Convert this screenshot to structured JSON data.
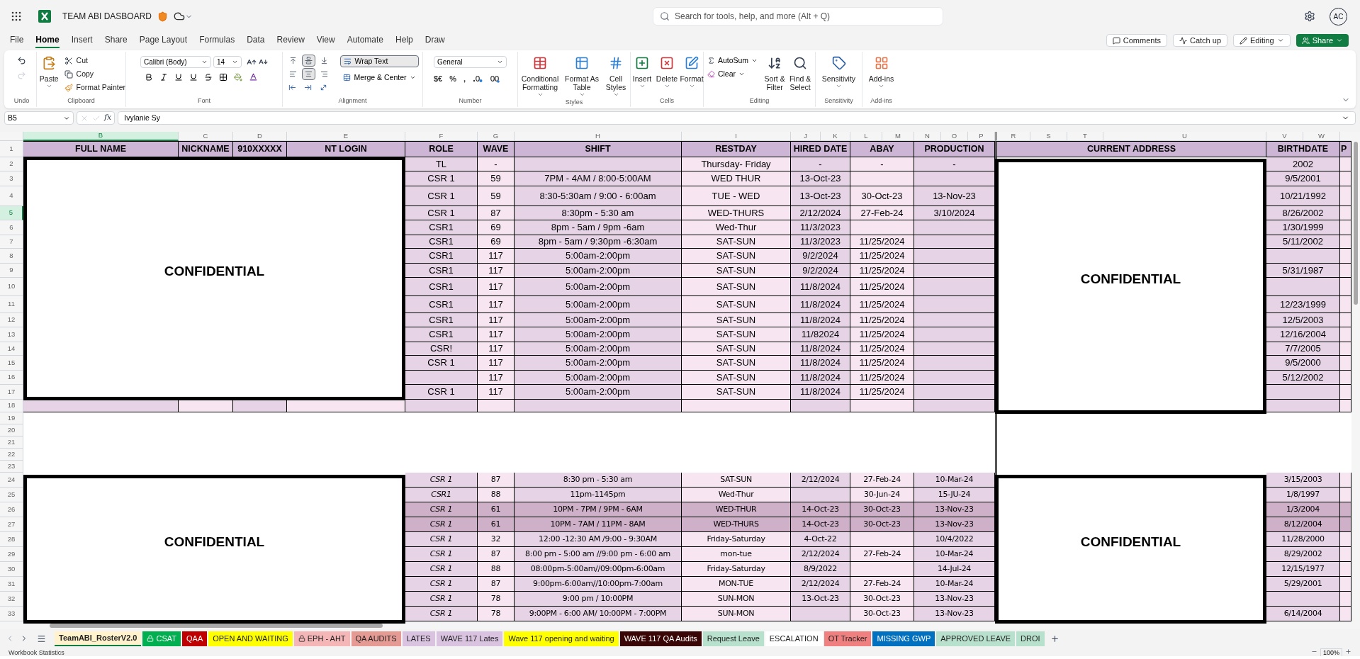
{
  "app": {
    "title": "TEAM ABI DASBOARD",
    "search": {
      "placeholder": "Search for tools, help, and more (Alt + Q)"
    },
    "avatar": "AC"
  },
  "menu": {
    "tabs": [
      {
        "label": "File",
        "selected": false
      },
      {
        "label": "Home",
        "selected": true
      },
      {
        "label": "Insert",
        "selected": false
      },
      {
        "label": "Share",
        "selected": false
      },
      {
        "label": "Page Layout",
        "selected": false
      },
      {
        "label": "Formulas",
        "selected": false
      },
      {
        "label": "Data",
        "selected": false
      },
      {
        "label": "Review",
        "selected": false
      },
      {
        "label": "View",
        "selected": false
      },
      {
        "label": "Automate",
        "selected": false
      },
      {
        "label": "Help",
        "selected": false
      },
      {
        "label": "Draw",
        "selected": false
      }
    ],
    "actions": [
      {
        "kind": "comments",
        "label": "Comments"
      },
      {
        "kind": "catchup",
        "label": "Catch up"
      },
      {
        "kind": "editing",
        "label": "Editing"
      },
      {
        "kind": "share",
        "label": "Share"
      }
    ]
  },
  "ribbon": {
    "groups": [
      {
        "kind": "undo",
        "label": "Undo",
        "buttons": [
          {
            "kind": "undo",
            "disabled": false
          },
          {
            "kind": "redo",
            "disabled": true
          }
        ]
      },
      {
        "kind": "clipboard",
        "label": "Clipboard",
        "paste": "Paste",
        "buttons": [
          "Cut",
          "Copy",
          "Format Painter"
        ]
      },
      {
        "kind": "font",
        "label": "Font",
        "font": "Calibri (Body)",
        "size": "14"
      },
      {
        "kind": "alignment",
        "label": "Alignment",
        "buttons": [
          {
            "kind": "top",
            "selected": false
          },
          {
            "kind": "middle",
            "selected": true
          },
          {
            "kind": "bottom",
            "selected": false
          },
          {
            "kind": "left",
            "selected": false
          },
          {
            "kind": "center",
            "selected": true
          },
          {
            "kind": "right",
            "selected": false
          }
        ],
        "wrap_text": {
          "label": "Wrap Text",
          "on": true
        },
        "merge": "Merge & Center"
      },
      {
        "kind": "number",
        "label": "Number",
        "format": "General",
        "symbols": [
          "$€",
          "%",
          ","
        ]
      },
      {
        "kind": "styles",
        "label": "Styles",
        "buttons": [
          "Conditional Formatting",
          "Format As Table",
          "Cell Styles"
        ]
      },
      {
        "kind": "cells",
        "label": "Cells",
        "buttons": [
          "Insert",
          "Delete",
          "Format"
        ]
      },
      {
        "kind": "editing",
        "label": "Editing",
        "buttons": [
          "AutoSum",
          "Clear",
          "Sort & Filter",
          "Find & Select"
        ]
      },
      {
        "kind": "sensitivity",
        "label": "Sensitivity",
        "buttons": [
          "Sensitivity"
        ]
      },
      {
        "kind": "addins",
        "label": "Add-ins",
        "buttons": [
          "Add-ins"
        ]
      }
    ]
  },
  "formula_bar": {
    "name_box": "B5",
    "fx": "fx",
    "value": "Ivylanie Sy"
  },
  "sheet": {
    "columns": [
      {
        "label": "B",
        "selected": true
      },
      {
        "label": "C",
        "selected": false
      },
      {
        "label": "D",
        "selected": false
      },
      {
        "label": "E",
        "selected": false
      },
      {
        "label": "F",
        "selected": false
      },
      {
        "label": "G",
        "selected": false
      },
      {
        "label": "H",
        "selected": false
      },
      {
        "label": "I",
        "selected": false
      },
      {
        "label": "J",
        "selected": false
      },
      {
        "label": "K",
        "selected": false
      },
      {
        "label": "L",
        "selected": false
      },
      {
        "label": "M",
        "selected": false
      },
      {
        "label": "N",
        "selected": false
      },
      {
        "label": "O",
        "selected": false
      },
      {
        "label": "P",
        "selected": false
      },
      {
        "label": "R",
        "selected": false
      },
      {
        "label": "S",
        "selected": false
      },
      {
        "label": "T",
        "selected": false
      },
      {
        "label": "U",
        "selected": false
      },
      {
        "label": "V",
        "selected": false
      },
      {
        "label": "W",
        "selected": false
      }
    ],
    "header_row": [
      "FULL NAME",
      "NICKNAME",
      "910XXXXX",
      "NT LOGIN",
      "ROLE",
      "WAVE",
      "SHIFT",
      "RESTDAY",
      "HIRED DATE",
      "ABAY",
      "PRODUCTION",
      "CURRENT ADDRESS",
      "BIRTHDATE",
      "P"
    ],
    "rows": [
      {
        "number": "1",
        "kind": "header",
        "selected": false
      },
      {
        "number": "2",
        "kind": "data",
        "selected": false,
        "highlighted": false,
        "role": "TL",
        "wave": "-",
        "restday": "Thursday- Friday",
        "hired_date": "-",
        "abay": "-",
        "production": "-",
        "birthdate": "2002"
      },
      {
        "number": "3",
        "kind": "data",
        "selected": false,
        "highlighted": false,
        "role": "CSR 1",
        "wave": "59",
        "shift": "7PM - 4AM / 8:00-5:00AM",
        "restday": "WED THUR",
        "hired_date": "13-Oct-23",
        "birthdate": "9/5/2001"
      },
      {
        "number": "4",
        "kind": "data",
        "selected": false,
        "highlighted": false,
        "role": "CSR 1",
        "wave": "59",
        "shift": "8:30-5:30am / 9:00 - 6:00am",
        "restday": "TUE - WED",
        "hired_date": "13-Oct-23",
        "abay": "30-Oct-23",
        "production": "13-Nov-23",
        "birthdate": "10/21/1992"
      },
      {
        "number": "5",
        "kind": "data",
        "selected": true,
        "highlighted": false,
        "role": "CSR 1",
        "wave": "87",
        "shift": "8:30pm - 5:30 am",
        "restday": "WED-THURS",
        "hired_date": "2/12/2024",
        "abay": "27-Feb-24",
        "production": "3/10/2024",
        "birthdate": "8/26/2002"
      },
      {
        "number": "6",
        "kind": "data",
        "selected": false,
        "highlighted": false,
        "role": "CSR1",
        "wave": "69",
        "shift": "8pm - 5am / 9pm -6am",
        "restday": "Wed-Thur",
        "hired_date": "11/3/2023",
        "birthdate": "1/30/1999"
      },
      {
        "number": "7",
        "kind": "data",
        "selected": false,
        "highlighted": false,
        "role": "CSR1",
        "wave": "69",
        "shift": "8pm - 5am / 9:30pm -6:30am",
        "restday": "SAT-SUN",
        "hired_date": "11/3/2023",
        "abay": "11/25/2024",
        "birthdate": "5/11/2002"
      },
      {
        "number": "8",
        "kind": "data",
        "selected": false,
        "highlighted": false,
        "role": "CSR1",
        "wave": "117",
        "shift": "5:00am-2:00pm",
        "restday": "SAT-SUN",
        "hired_date": "9/2/2024",
        "abay": "11/25/2024"
      },
      {
        "number": "9",
        "kind": "data",
        "selected": false,
        "highlighted": false,
        "role": "CSR1",
        "wave": "117",
        "shift": "5:00am-2:00pm",
        "restday": "SAT-SUN",
        "hired_date": "9/2/2024",
        "abay": "11/25/2024",
        "birthdate": "5/31/1987"
      },
      {
        "number": "10",
        "kind": "data",
        "selected": false,
        "highlighted": false,
        "role": "CSR1",
        "wave": "117",
        "shift": "5:00am-2:00pm",
        "restday": "SAT-SUN",
        "hired_date": "11/8/2024",
        "abay": "11/25/2024"
      },
      {
        "number": "11",
        "kind": "data",
        "selected": false,
        "highlighted": false,
        "role": "CSR1",
        "wave": "117",
        "shift": "5:00am-2:00pm",
        "restday": "SAT-SUN",
        "hired_date": "11/8/2024",
        "abay": "11/25/2024",
        "birthdate": "12/23/1999"
      },
      {
        "number": "12",
        "kind": "data",
        "selected": false,
        "highlighted": false,
        "role": "CSR1",
        "wave": "117",
        "shift": "5:00am-2:00pm",
        "restday": "SAT-SUN",
        "hired_date": "11/8/2024",
        "abay": "11/25/2024",
        "birthdate": "12/5/2003"
      },
      {
        "number": "13",
        "kind": "data",
        "selected": false,
        "highlighted": false,
        "role": "CSR1",
        "wave": "117",
        "shift": "5:00am-2:00pm",
        "restday": "SAT-SUN",
        "hired_date": "11/82024",
        "abay": "11/25/2024",
        "birthdate": "12/16/2004"
      },
      {
        "number": "14",
        "kind": "data",
        "selected": false,
        "highlighted": false,
        "role": "CSR!",
        "wave": "117",
        "shift": "5:00am-2:00pm",
        "restday": "SAT-SUN",
        "hired_date": "11/8/2024",
        "abay": "11/25/2024",
        "birthdate": "7/7/2005"
      },
      {
        "number": "15",
        "kind": "data",
        "selected": false,
        "highlighted": false,
        "role": "CSR 1",
        "wave": "117",
        "shift": "5:00am-2:00pm",
        "restday": "SAT-SUN",
        "hired_date": "11/8/2024",
        "abay": "11/25/2024",
        "birthdate": "9/5/2000"
      },
      {
        "number": "16",
        "kind": "data",
        "selected": false,
        "highlighted": false,
        "wave": "117",
        "shift": "5:00am-2:00pm",
        "restday": "SAT-SUN",
        "hired_date": "11/8/2024",
        "abay": "11/25/2024",
        "birthdate": "5/12/2002"
      },
      {
        "number": "17",
        "kind": "data",
        "selected": false,
        "highlighted": false,
        "role": "CSR 1",
        "wave": "117",
        "shift": "5:00am-2:00pm",
        "restday": "SAT-SUN",
        "hired_date": "11/8/2024",
        "abay": "11/25/2024"
      },
      {
        "number": "18",
        "kind": "data",
        "selected": false,
        "highlighted": false
      },
      {
        "number": "19",
        "kind": "blank",
        "selected": false
      },
      {
        "number": "20",
        "kind": "blank",
        "selected": false
      },
      {
        "number": "21",
        "kind": "blank",
        "selected": false
      },
      {
        "number": "22",
        "kind": "blank",
        "selected": false
      },
      {
        "number": "23",
        "kind": "blank",
        "selected": false
      },
      {
        "number": "24",
        "kind": "data",
        "selected": false,
        "highlighted": false,
        "role": "CSR 1",
        "wave": "87",
        "shift": "8:30 pm - 5:30 am",
        "restday": "SAT-SUN",
        "hired_date": "2/12/2024",
        "abay": "27-Feb-24",
        "production": "10-Mar-24",
        "birthdate": "3/15/2003"
      },
      {
        "number": "25",
        "kind": "data",
        "selected": false,
        "highlighted": false,
        "role": "CSR1",
        "wave": "88",
        "shift": "11pm-1145pm",
        "restday": "Wed-Thur",
        "abay": "30-Jun-24",
        "production": "15-JU-24",
        "birthdate": "1/8/1997"
      },
      {
        "number": "26",
        "kind": "data",
        "selected": false,
        "highlighted": true,
        "role": "CSR 1",
        "wave": "61",
        "shift": "10PM - 7PM / 9PM - 6AM",
        "restday": "WED-THUR",
        "hired_date": "14-Oct-23",
        "abay": "30-Oct-23",
        "production": "13-Nov-23",
        "birthdate": "1/3/2004"
      },
      {
        "number": "27",
        "kind": "data",
        "selected": false,
        "highlighted": true,
        "role": "CSR 1",
        "wave": "61",
        "shift": "10PM - 7AM / 11PM - 8AM",
        "restday": "WED-THURS",
        "hired_date": "14-Oct-23",
        "abay": "30-Oct-23",
        "production": "13-Nov-23",
        "birthdate": "8/12/2004"
      },
      {
        "number": "28",
        "kind": "data",
        "selected": false,
        "highlighted": false,
        "role": "CSR 1",
        "wave": "32",
        "shift": "12:00 -12:30 AM /9:00 - 9:30AM",
        "restday": "Friday-Saturday",
        "hired_date": "4-Oct-22",
        "production": "10/4/2022",
        "birthdate": "11/28/2000"
      },
      {
        "number": "29",
        "kind": "data",
        "selected": false,
        "highlighted": false,
        "role": "CSR 1",
        "wave": "87",
        "shift": "8:00 pm - 5:00 am //9:00 pm - 6:00 am",
        "restday": "mon-tue",
        "hired_date": "2/12/2024",
        "abay": "27-Feb-24",
        "production": "10-Mar-24",
        "birthdate": "8/29/2002"
      },
      {
        "number": "30",
        "kind": "data",
        "selected": false,
        "highlighted": false,
        "role": "CSR 1",
        "wave": "88",
        "shift": "08:00pm-5:00am//09:00pm-6:00am",
        "restday": "Friday-Saturday",
        "hired_date": "8/9/2022",
        "production": "14-Jul-24",
        "birthdate": "12/15/1977"
      },
      {
        "number": "31",
        "kind": "data",
        "selected": false,
        "highlighted": false,
        "role": "CSR 1",
        "wave": "87",
        "shift": "9:00pm-6:00am//10:00pm-7:00am",
        "restday": "MON-TUE",
        "hired_date": "2/12/2024",
        "abay": "27-Feb-24",
        "production": "10-Mar-24",
        "birthdate": "5/29/2001"
      },
      {
        "number": "32",
        "kind": "data",
        "selected": false,
        "highlighted": false,
        "role": "CSR 1",
        "wave": "78",
        "shift": "9:00 pm / 10:00PM",
        "restday": "SUN-MON",
        "hired_date": "13-Oct-23",
        "abay": "30-Oct-23",
        "production": "13-Nov-23"
      },
      {
        "number": "33",
        "kind": "data",
        "selected": false,
        "highlighted": false,
        "role": "CSR 1",
        "wave": "78",
        "shift": "9:00PM - 6:00 AM/ 10:00PM - 7:00PM",
        "restday": "SUN-MON",
        "abay": "30-Oct-23",
        "production": "13-Nov-23",
        "birthdate": "6/14/2004"
      }
    ],
    "confidential_boxes": [
      {
        "text": "CONFIDENTIAL"
      },
      {
        "text": "CONFIDENTIAL"
      },
      {
        "text": "CONFIDENTIAL"
      },
      {
        "text": "CONFIDENTIAL"
      }
    ]
  },
  "sheet_tabs": [
    {
      "label": "TeamABI_RosterV2.0",
      "selected": true,
      "locked": false,
      "color": "#fff2cc"
    },
    {
      "label": "CSAT",
      "selected": false,
      "locked": true,
      "color": "#00b050"
    },
    {
      "label": "QAA",
      "selected": false,
      "locked": false,
      "color": "#c00000"
    },
    {
      "label": "OPEN AND WAITING",
      "selected": false,
      "locked": false,
      "color": "#ffff00"
    },
    {
      "label": "EPH - AHT",
      "selected": false,
      "locked": true,
      "color": "#f4b6b6"
    },
    {
      "label": "QA AUDITS",
      "selected": false,
      "locked": false,
      "color": "#e59a94"
    },
    {
      "label": "LATES",
      "selected": false,
      "locked": false,
      "color": "#d9c3e0"
    },
    {
      "label": "WAVE 117 Lates",
      "selected": false,
      "locked": false,
      "color": "#d9c3e0"
    },
    {
      "label": "Wave 117 opening and waiting",
      "selected": false,
      "locked": false,
      "color": "#ffff00"
    },
    {
      "label": "WAVE 117 QA Audits",
      "selected": false,
      "locked": false,
      "color": "#3a0505"
    },
    {
      "label": "Request Leave",
      "selected": false,
      "locked": false,
      "color": "#b7e1cd"
    },
    {
      "label": "ESCALATION",
      "selected": false,
      "locked": false
    },
    {
      "label": "OT Tracker",
      "selected": false,
      "locked": false,
      "color": "#f08080"
    },
    {
      "label": "MISSING GWP",
      "selected": false,
      "locked": false,
      "color": "#0070c0"
    },
    {
      "label": "APPROVED LEAVE",
      "selected": false,
      "locked": false,
      "color": "#b7e1cd"
    },
    {
      "label": "DROI",
      "selected": false,
      "locked": false,
      "color": "#b7e1cd"
    }
  ],
  "status_bar": {
    "text": "Workbook Statistics",
    "zoom": "100%"
  }
}
